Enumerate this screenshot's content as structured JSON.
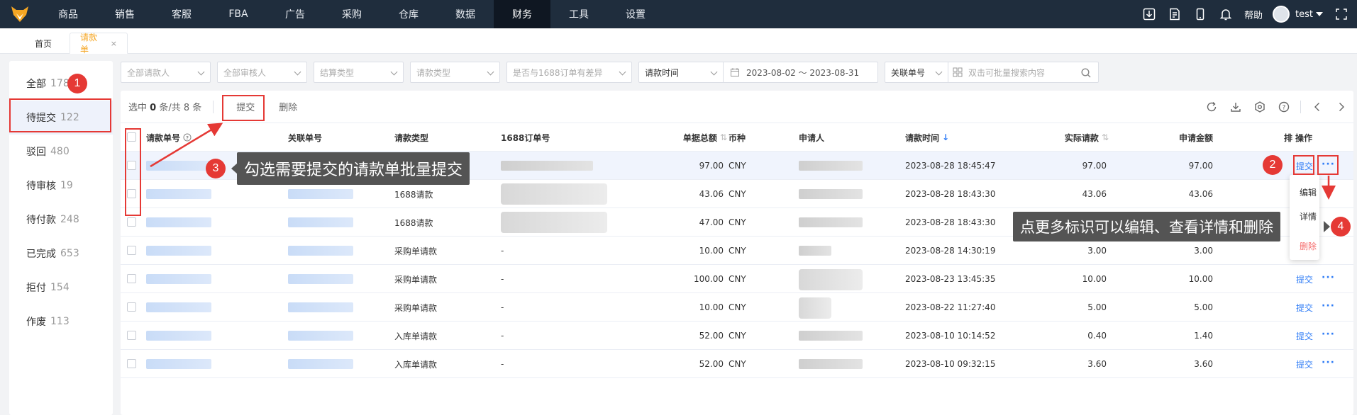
{
  "nav": {
    "items": [
      "商品",
      "销售",
      "客服",
      "FBA",
      "广告",
      "采购",
      "仓库",
      "数据",
      "财务",
      "工具",
      "设置"
    ],
    "active_index": 8,
    "help": "帮助",
    "user": "test"
  },
  "tabs": {
    "home": "首页",
    "current": "请款单",
    "close": "×"
  },
  "status_list": [
    {
      "label": "全部",
      "count": "178"
    },
    {
      "label": "待提交",
      "count": "122"
    },
    {
      "label": "驳回",
      "count": "480"
    },
    {
      "label": "待审核",
      "count": "19"
    },
    {
      "label": "待付款",
      "count": "248"
    },
    {
      "label": "已完成",
      "count": "653"
    },
    {
      "label": "拒付",
      "count": "154"
    },
    {
      "label": "作废",
      "count": "113"
    }
  ],
  "filters": {
    "applicant": "全部请款人",
    "reviewer": "全部审核人",
    "settle_type": "结算类型",
    "request_type": "请款类型",
    "diff_1688": "是否与1688订单有差异",
    "time_type": "请款时间",
    "date_range": "2023-08-02 ～ 2023-08-31",
    "order_type": "关联单号",
    "search_placeholder": "双击可批量搜索内容"
  },
  "toolbar": {
    "sel_prefix": "选中",
    "sel_count": "0",
    "sel_suffix": "条/共 8 条",
    "submit": "提交",
    "delete": "删除"
  },
  "table": {
    "headers": {
      "request_no": "请款单号",
      "related_no": "关联单号",
      "request_type": "请款类型",
      "order_1688": "1688订单号",
      "total": "单据总额",
      "currency": "币种",
      "applicant": "申请人",
      "time": "请款时间",
      "actual": "实际请款",
      "apply_amount": "申请金额",
      "ops": "操作",
      "cut": "排"
    },
    "rows": [
      {
        "type": "",
        "order": "",
        "total": "97.00",
        "currency": "CNY",
        "time": "2023-08-28 18:45:47",
        "actual": "97.00",
        "apply": "97.00"
      },
      {
        "type": "1688请款",
        "order": "",
        "total": "43.06",
        "currency": "CNY",
        "time": "2023-08-28 18:43:30",
        "actual": "43.06",
        "apply": "43.06"
      },
      {
        "type": "1688请款",
        "order": "",
        "total": "47.00",
        "currency": "CNY",
        "time": "2023-08-28 18:43:30",
        "actual": "",
        "apply": ""
      },
      {
        "type": "采购单请款",
        "order": "-",
        "total": "10.00",
        "currency": "CNY",
        "time": "2023-08-28 14:30:19",
        "actual": "3.00",
        "apply": "3.00"
      },
      {
        "type": "采购单请款",
        "order": "-",
        "total": "100.00",
        "currency": "CNY",
        "time": "2023-08-23 13:45:35",
        "actual": "10.00",
        "apply": "10.00"
      },
      {
        "type": "采购单请款",
        "order": "-",
        "total": "10.00",
        "currency": "CNY",
        "time": "2023-08-22 11:27:40",
        "actual": "5.00",
        "apply": "5.00"
      },
      {
        "type": "入库单请款",
        "order": "-",
        "total": "52.00",
        "currency": "CNY",
        "time": "2023-08-10 10:14:52",
        "actual": "0.40",
        "apply": "1.40"
      },
      {
        "type": "入库单请款",
        "order": "-",
        "total": "52.00",
        "currency": "CNY",
        "time": "2023-08-10 09:32:15",
        "actual": "3.60",
        "apply": "3.60"
      }
    ],
    "op_submit": "提交",
    "op_more": "···"
  },
  "dropdown": {
    "edit": "编辑",
    "detail": "详情",
    "delete": "删除"
  },
  "annotations": {
    "n1": "1",
    "n2": "2",
    "n3": "3",
    "n4": "4",
    "callout3": "勾选需要提交的请款单批量提交",
    "callout4": "点更多标识可以编辑、查看详情和删除"
  },
  "colors": {
    "nav_bg": "#1f2d3d",
    "accent": "#2f7cf6",
    "tab_active": "#f5a623",
    "annotation": "#e53935"
  }
}
